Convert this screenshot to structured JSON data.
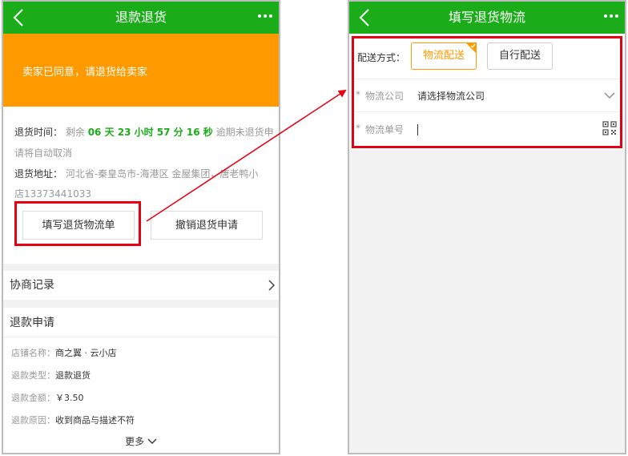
{
  "left": {
    "header": {
      "title": "退款退货"
    },
    "banner": {
      "text": "卖家已同意，请退货给卖家"
    },
    "return_info": {
      "time_label": "退货时间：",
      "time_prefix": "剩余",
      "countdown": "06 天 23 小时 57 分 16 秒",
      "time_suffix_1": "逾期未退货申",
      "time_suffix_2": "请将自动取消",
      "address_label": "退货地址：",
      "address_1": "河北省-秦皇岛市-海港区 金屋集团，唐老鸭小",
      "address_2": "店13373441033"
    },
    "buttons": {
      "fill_logistics": "填写退货物流单",
      "cancel_return": "撤销退货申请"
    },
    "negotiation": {
      "label": "协商记录"
    },
    "refund": {
      "section_title": "退款申请",
      "rows": [
        {
          "label": "店铺名称：",
          "value": "商之翼 · 云小店"
        },
        {
          "label": "退款类型：",
          "value": "退款退货"
        },
        {
          "label": "退款金额：",
          "value": "￥3.50"
        },
        {
          "label": "退款原因：",
          "value": "收到商品与描述不符"
        }
      ],
      "more": "更多"
    }
  },
  "right": {
    "header": {
      "title": "填写退货物流"
    },
    "delivery": {
      "label": "配送方式：",
      "options": [
        {
          "label": "物流配送",
          "selected": true
        },
        {
          "label": "自行配送",
          "selected": false
        }
      ]
    },
    "company": {
      "required": "*",
      "label": "物流公司",
      "placeholder": "请选择物流公司"
    },
    "tracking": {
      "required": "*",
      "label": "物流单号",
      "value": ""
    }
  },
  "colors": {
    "green": "#1aad19",
    "orange": "#ff9900",
    "highlight": "#e60012"
  },
  "icons": [
    "back-arrow-icon",
    "more-icon",
    "chevron-right-icon",
    "chevron-down-icon",
    "qr-scan-icon",
    "check-corner-icon"
  ]
}
